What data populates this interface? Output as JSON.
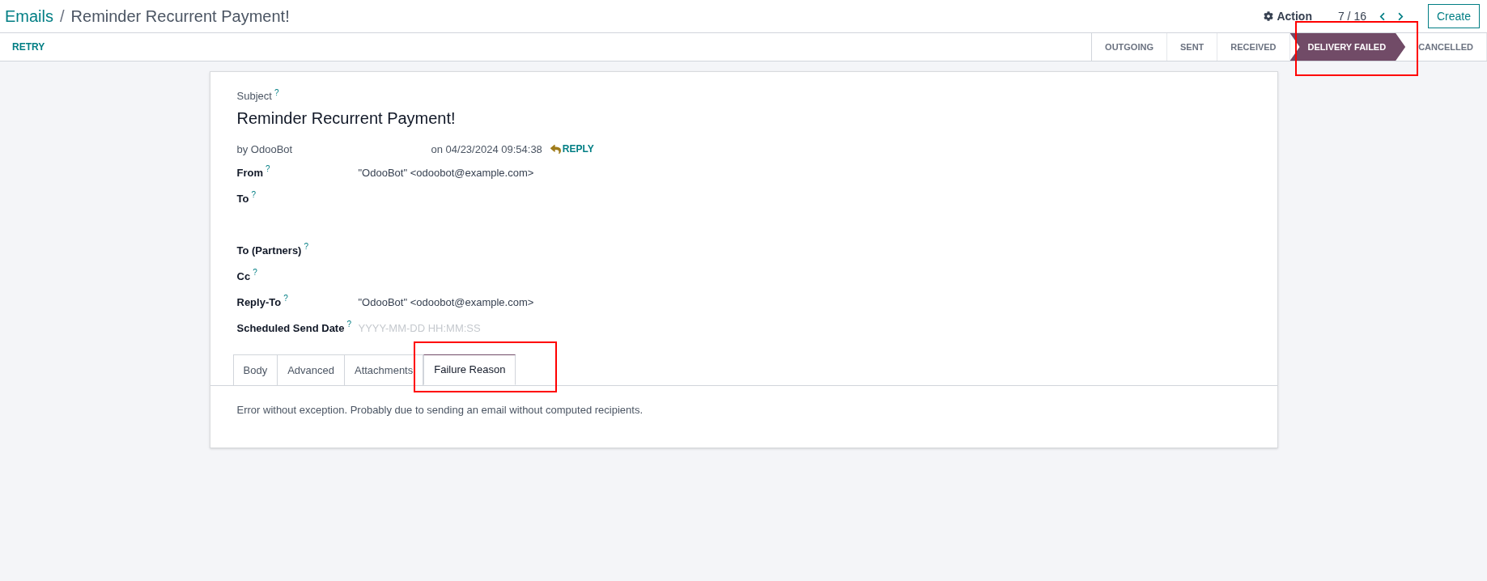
{
  "breadcrumb": {
    "parent": "Emails",
    "separator": "/",
    "current": "Reminder Recurrent Payment!"
  },
  "toolbar": {
    "action": "Action",
    "pager": "7 / 16",
    "create": "Create"
  },
  "status_bar": {
    "button": "RETRY",
    "stages": [
      {
        "label": "OUTGOING",
        "selected": false
      },
      {
        "label": "SENT",
        "selected": false
      },
      {
        "label": "RECEIVED",
        "selected": false
      },
      {
        "label": "DELIVERY FAILED",
        "selected": true
      },
      {
        "label": "CANCELLED",
        "selected": false
      }
    ]
  },
  "form": {
    "subject_label": "Subject",
    "help_mark": "?",
    "subject": "Reminder Recurrent Payment!",
    "author": "by OdooBot",
    "date": "on 04/23/2024 09:54:38",
    "reply": "REPLY",
    "fields": [
      {
        "label": "From",
        "help": "?",
        "value": "\"OdooBot\" <odoobot@example.com>"
      },
      {
        "label": "To",
        "help": "?",
        "kind": "tall"
      },
      {
        "label": "To (Partners)",
        "help": "?"
      },
      {
        "label": "Cc",
        "help": "?"
      },
      {
        "label": "Reply-To",
        "help": "?",
        "value": "\"OdooBot\" <odoobot@example.com>"
      },
      {
        "label": "Scheduled Send Date",
        "help": "?",
        "placeholder": "YYYY-MM-DD HH:MM:SS"
      }
    ],
    "tabs": [
      {
        "label": "Body",
        "selected": false
      },
      {
        "label": "Advanced",
        "selected": false
      },
      {
        "label": "Attachments",
        "selected": false
      },
      {
        "label": "Failure Reason",
        "selected": true
      }
    ],
    "tab_content": "Error without exception. Probably due to sending an email without computed recipients."
  }
}
